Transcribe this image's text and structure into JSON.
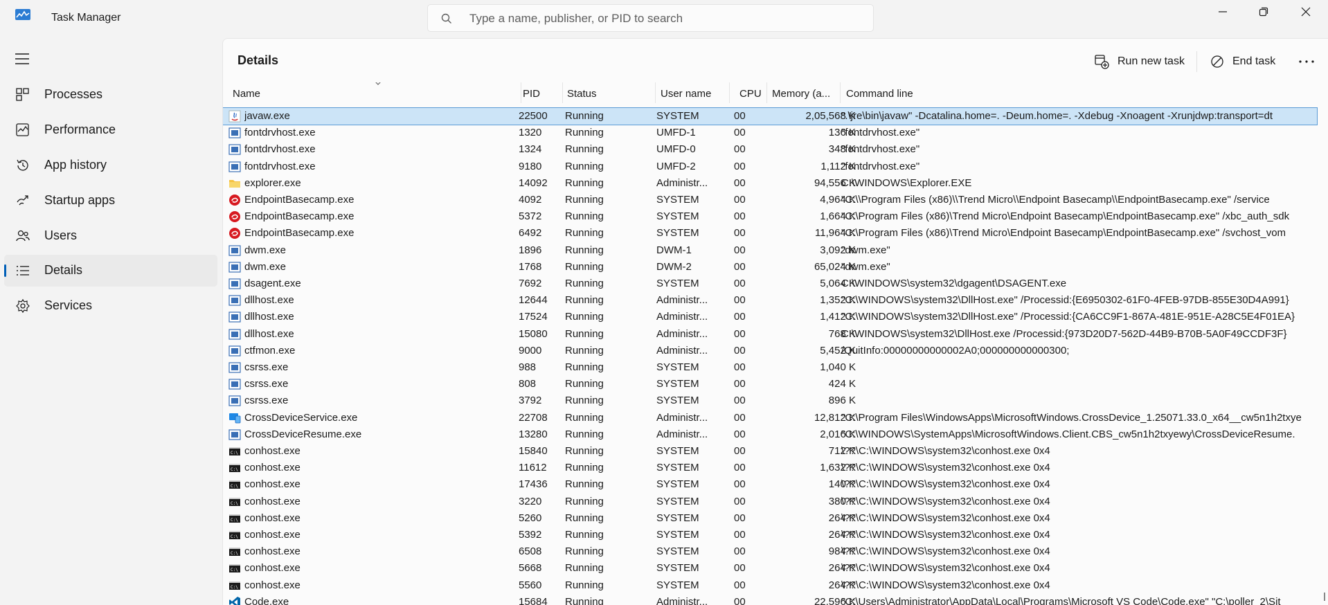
{
  "app": {
    "title": "Task Manager"
  },
  "search": {
    "placeholder": "Type a name, publisher, or PID to search"
  },
  "sidebar": {
    "items": [
      {
        "label": "Processes",
        "icon": "processes-icon"
      },
      {
        "label": "Performance",
        "icon": "performance-icon"
      },
      {
        "label": "App history",
        "icon": "history-icon"
      },
      {
        "label": "Startup apps",
        "icon": "startup-icon"
      },
      {
        "label": "Users",
        "icon": "users-icon"
      },
      {
        "label": "Details",
        "icon": "details-icon",
        "active": true
      },
      {
        "label": "Services",
        "icon": "services-icon"
      }
    ]
  },
  "page": {
    "title": "Details"
  },
  "toolbar": {
    "run_new_task": "Run new task",
    "end_task": "End task"
  },
  "table": {
    "columns": [
      "Name",
      "PID",
      "Status",
      "User name",
      "CPU",
      "Memory (a...",
      "Command line"
    ],
    "rows": [
      {
        "name": "javaw.exe",
        "pid": "22500",
        "status": "Running",
        "user": "SYSTEM",
        "cpu": "00",
        "mem": "2,05,568 K",
        "cmd": "\".\\jre\\bin\\javaw\" -Dcatalina.home=. -Deum.home=. -Xdebug -Xnoagent -Xrunjdwp:transport=dt",
        "icon": "java"
      },
      {
        "name": "fontdrvhost.exe",
        "pid": "1320",
        "status": "Running",
        "user": "UMFD-1",
        "cpu": "00",
        "mem": "136 K",
        "cmd": "\"fontdrvhost.exe\"",
        "icon": "win"
      },
      {
        "name": "fontdrvhost.exe",
        "pid": "1324",
        "status": "Running",
        "user": "UMFD-0",
        "cpu": "00",
        "mem": "348 K",
        "cmd": "\"fontdrvhost.exe\"",
        "icon": "win"
      },
      {
        "name": "fontdrvhost.exe",
        "pid": "9180",
        "status": "Running",
        "user": "UMFD-2",
        "cpu": "00",
        "mem": "1,112 K",
        "cmd": "\"fontdrvhost.exe\"",
        "icon": "win"
      },
      {
        "name": "explorer.exe",
        "pid": "14092",
        "status": "Running",
        "user": "Administr...",
        "cpu": "00",
        "mem": "94,556 K",
        "cmd": "C:\\WINDOWS\\Explorer.EXE",
        "icon": "folder"
      },
      {
        "name": "EndpointBasecamp.exe",
        "pid": "4092",
        "status": "Running",
        "user": "SYSTEM",
        "cpu": "00",
        "mem": "4,964 K",
        "cmd": "\"C:\\\\Program Files (x86)\\\\Trend Micro\\\\Endpoint Basecamp\\\\EndpointBasecamp.exe\" /service",
        "icon": "trend"
      },
      {
        "name": "EndpointBasecamp.exe",
        "pid": "5372",
        "status": "Running",
        "user": "SYSTEM",
        "cpu": "00",
        "mem": "1,664 K",
        "cmd": "\"C:\\Program Files (x86)\\Trend Micro\\Endpoint Basecamp\\EndpointBasecamp.exe\" /xbc_auth_sdk",
        "icon": "trend"
      },
      {
        "name": "EndpointBasecamp.exe",
        "pid": "6492",
        "status": "Running",
        "user": "SYSTEM",
        "cpu": "00",
        "mem": "11,964 K",
        "cmd": "\"C:\\Program Files (x86)\\Trend Micro\\Endpoint Basecamp\\EndpointBasecamp.exe\" /svchost_vom",
        "icon": "trend"
      },
      {
        "name": "dwm.exe",
        "pid": "1896",
        "status": "Running",
        "user": "DWM-1",
        "cpu": "00",
        "mem": "3,092 K",
        "cmd": "\"dwm.exe\"",
        "icon": "win"
      },
      {
        "name": "dwm.exe",
        "pid": "1768",
        "status": "Running",
        "user": "DWM-2",
        "cpu": "00",
        "mem": "65,024 K",
        "cmd": "\"dwm.exe\"",
        "icon": "win"
      },
      {
        "name": "dsagent.exe",
        "pid": "7692",
        "status": "Running",
        "user": "SYSTEM",
        "cpu": "00",
        "mem": "5,064 K",
        "cmd": "C:\\WINDOWS\\system32\\dgagent\\DSAGENT.exe",
        "icon": "win"
      },
      {
        "name": "dllhost.exe",
        "pid": "12644",
        "status": "Running",
        "user": "Administr...",
        "cpu": "00",
        "mem": "1,352 K",
        "cmd": "\"C:\\WINDOWS\\system32\\DllHost.exe\" /Processid:{E6950302-61F0-4FEB-97DB-855E30D4A991}",
        "icon": "win"
      },
      {
        "name": "dllhost.exe",
        "pid": "17524",
        "status": "Running",
        "user": "Administr...",
        "cpu": "00",
        "mem": "1,412 K",
        "cmd": "\"C:\\WINDOWS\\system32\\DllHost.exe\" /Processid:{CA6CC9F1-867A-481E-951E-A28C5E4F01EA}",
        "icon": "win"
      },
      {
        "name": "dllhost.exe",
        "pid": "15080",
        "status": "Running",
        "user": "Administr...",
        "cpu": "00",
        "mem": "768 K",
        "cmd": "C:\\WINDOWS\\system32\\DllHost.exe /Processid:{973D20D7-562D-44B9-B70B-5A0F49CCDF3F}",
        "icon": "win"
      },
      {
        "name": "ctfmon.exe",
        "pid": "9000",
        "status": "Running",
        "user": "Administr...",
        "cpu": "00",
        "mem": "5,452 K",
        "cmd": "/QuitInfo:00000000000002A0;000000000000300;",
        "icon": "win"
      },
      {
        "name": "csrss.exe",
        "pid": "988",
        "status": "Running",
        "user": "SYSTEM",
        "cpu": "00",
        "mem": "1,040 K",
        "cmd": "",
        "icon": "win"
      },
      {
        "name": "csrss.exe",
        "pid": "808",
        "status": "Running",
        "user": "SYSTEM",
        "cpu": "00",
        "mem": "424 K",
        "cmd": "",
        "icon": "win"
      },
      {
        "name": "csrss.exe",
        "pid": "3792",
        "status": "Running",
        "user": "SYSTEM",
        "cpu": "00",
        "mem": "896 K",
        "cmd": "",
        "icon": "win"
      },
      {
        "name": "CrossDeviceService.exe",
        "pid": "22708",
        "status": "Running",
        "user": "Administr...",
        "cpu": "00",
        "mem": "12,812 K",
        "cmd": "\"C:\\Program Files\\WindowsApps\\MicrosoftWindows.CrossDevice_1.25071.33.0_x64__cw5n1h2txye",
        "icon": "cross"
      },
      {
        "name": "CrossDeviceResume.exe",
        "pid": "13280",
        "status": "Running",
        "user": "Administr...",
        "cpu": "00",
        "mem": "2,016 K",
        "cmd": "\"C:\\WINDOWS\\SystemApps\\MicrosoftWindows.Client.CBS_cw5n1h2txyewy\\CrossDeviceResume.",
        "icon": "win"
      },
      {
        "name": "conhost.exe",
        "pid": "15840",
        "status": "Running",
        "user": "SYSTEM",
        "cpu": "00",
        "mem": "712 K",
        "cmd": "\\??\\C:\\WINDOWS\\system32\\conhost.exe 0x4",
        "icon": "console"
      },
      {
        "name": "conhost.exe",
        "pid": "11612",
        "status": "Running",
        "user": "SYSTEM",
        "cpu": "00",
        "mem": "1,632 K",
        "cmd": "\\??\\C:\\WINDOWS\\system32\\conhost.exe 0x4",
        "icon": "console"
      },
      {
        "name": "conhost.exe",
        "pid": "17436",
        "status": "Running",
        "user": "SYSTEM",
        "cpu": "00",
        "mem": "140 K",
        "cmd": "\\??\\C:\\WINDOWS\\system32\\conhost.exe 0x4",
        "icon": "console"
      },
      {
        "name": "conhost.exe",
        "pid": "3220",
        "status": "Running",
        "user": "SYSTEM",
        "cpu": "00",
        "mem": "380 K",
        "cmd": "\\??\\C:\\WINDOWS\\system32\\conhost.exe 0x4",
        "icon": "console"
      },
      {
        "name": "conhost.exe",
        "pid": "5260",
        "status": "Running",
        "user": "SYSTEM",
        "cpu": "00",
        "mem": "264 K",
        "cmd": "\\??\\C:\\WINDOWS\\system32\\conhost.exe 0x4",
        "icon": "console"
      },
      {
        "name": "conhost.exe",
        "pid": "5392",
        "status": "Running",
        "user": "SYSTEM",
        "cpu": "00",
        "mem": "264 K",
        "cmd": "\\??\\C:\\WINDOWS\\system32\\conhost.exe 0x4",
        "icon": "console"
      },
      {
        "name": "conhost.exe",
        "pid": "6508",
        "status": "Running",
        "user": "SYSTEM",
        "cpu": "00",
        "mem": "984 K",
        "cmd": "\\??\\C:\\WINDOWS\\system32\\conhost.exe 0x4",
        "icon": "console"
      },
      {
        "name": "conhost.exe",
        "pid": "5668",
        "status": "Running",
        "user": "SYSTEM",
        "cpu": "00",
        "mem": "264 K",
        "cmd": "\\??\\C:\\WINDOWS\\system32\\conhost.exe 0x4",
        "icon": "console"
      },
      {
        "name": "conhost.exe",
        "pid": "5560",
        "status": "Running",
        "user": "SYSTEM",
        "cpu": "00",
        "mem": "264 K",
        "cmd": "\\??\\C:\\WINDOWS\\system32\\conhost.exe 0x4",
        "icon": "console"
      },
      {
        "name": "Code.exe",
        "pid": "15684",
        "status": "Running",
        "user": "Administr...",
        "cpu": "00",
        "mem": "22,596 K",
        "cmd": "\"C:\\Users\\Administrator\\AppData\\Local\\Programs\\Microsoft VS Code\\Code.exe\" \"C:\\poller_2\\Sit",
        "icon": "vscode"
      }
    ]
  },
  "colors": {
    "accent": "#005fb8",
    "selected_row": "#cce4f7",
    "panel_bg": "#fbfbfb",
    "window_bg": "#f3f3f3"
  }
}
